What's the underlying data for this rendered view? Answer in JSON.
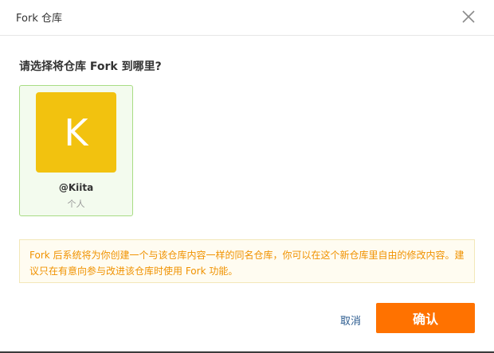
{
  "dialog": {
    "title": "Fork 仓库",
    "question": "请选择将仓库 Fork 到哪里?"
  },
  "owner": {
    "avatar_letter": "K",
    "avatar_color": "#f2c20f",
    "name": "@Kiita",
    "type": "个人"
  },
  "notice": {
    "text": "Fork 后系统将为你创建一个与该仓库内容一样的同名仓库，你可以在这个新仓库里自由的修改内容。建议只在有意向参与改进该仓库时使用 Fork 功能。"
  },
  "actions": {
    "cancel_label": "取消",
    "confirm_label": "确认",
    "confirm_color": "#ff7200"
  },
  "icons": {
    "close": "close-icon"
  }
}
